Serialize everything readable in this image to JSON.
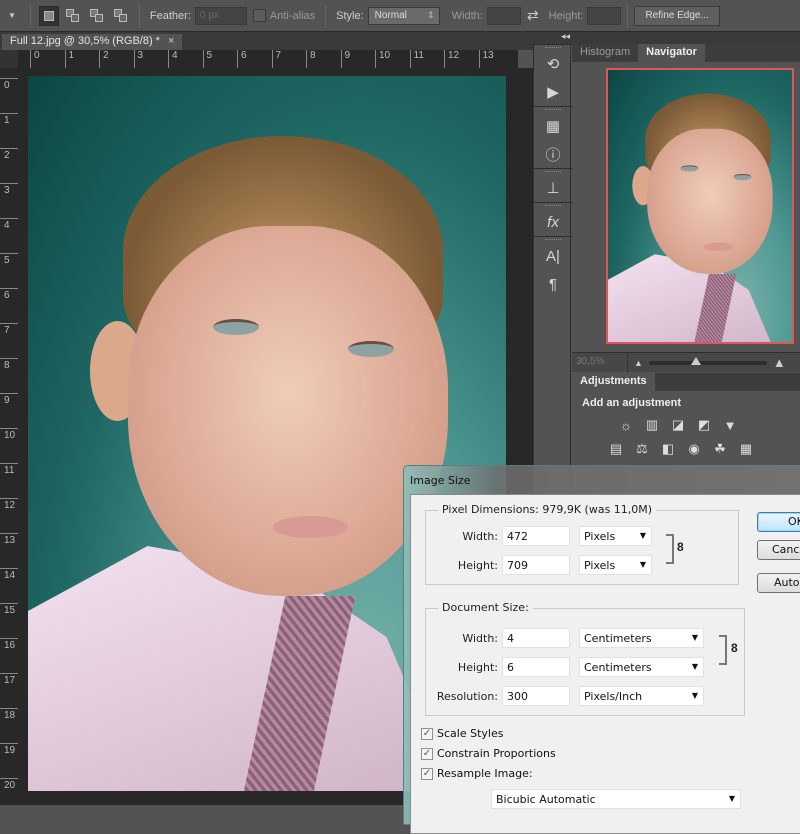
{
  "options_bar": {
    "feather_label": "Feather:",
    "feather_value": "0 px",
    "anti_alias_label": "Anti-alias",
    "style_label": "Style:",
    "style_value": "Normal",
    "width_label": "Width:",
    "height_label": "Height:",
    "refine_edge_label": "Refine Edge..."
  },
  "document": {
    "tab_title": "Full 12.jpg @ 30,5% (RGB/8) *",
    "close_glyph": "×",
    "ruler_h": [
      "0",
      "1",
      "2",
      "3",
      "4",
      "5",
      "6",
      "7",
      "8",
      "9",
      "10",
      "11",
      "12",
      "13"
    ],
    "ruler_v": [
      "0",
      "1",
      "2",
      "3",
      "4",
      "5",
      "6",
      "7",
      "8",
      "9",
      "10",
      "11",
      "12",
      "13",
      "14",
      "15",
      "16",
      "17",
      "18",
      "19",
      "20"
    ]
  },
  "panels": {
    "collapse_glyph": "◂◂",
    "tabs": [
      {
        "label": "Histogram",
        "active": false
      },
      {
        "label": "Navigator",
        "active": true
      }
    ],
    "navigator": {
      "zoom_value": "30,5%",
      "zoom_slider_fraction": 0.4
    },
    "adjustments": {
      "tab_label": "Adjustments",
      "title": "Add an adjustment",
      "row1_icons": [
        "brightness-contrast-icon",
        "levels-icon",
        "curves-icon",
        "exposure-icon",
        "vibrance-icon"
      ],
      "row2_icons": [
        "hue-saturation-icon",
        "color-balance-icon",
        "black-white-icon",
        "photo-filter-icon",
        "channel-mixer-icon",
        "color-lookup-icon"
      ]
    }
  },
  "dialog": {
    "title": "Image Size",
    "pixel_dimensions": {
      "legend": "Pixel Dimensions:  979,9K (was 11,0M)",
      "width_label": "Width:",
      "width_value": "472",
      "width_unit": "Pixels",
      "height_label": "Height:",
      "height_value": "709",
      "height_unit": "Pixels"
    },
    "document_size": {
      "legend": "Document Size:",
      "width_label": "Width:",
      "width_value": "4",
      "width_unit": "Centimeters",
      "height_label": "Height:",
      "height_value": "6",
      "height_unit": "Centimeters",
      "resolution_label": "Resolution:",
      "resolution_value": "300",
      "resolution_unit": "Pixels/Inch"
    },
    "checkboxes": [
      {
        "label": "Scale Styles",
        "checked": true
      },
      {
        "label": "Constrain Proportions",
        "checked": true
      },
      {
        "label": "Resample Image:",
        "checked": true
      }
    ],
    "resample_method": "Bicubic Automatic",
    "buttons": {
      "ok": "OK",
      "cancel": "Canc",
      "auto": "Auto"
    },
    "check_glyph": "✓",
    "dropdown_glyph": "▼",
    "link_glyph": "8"
  }
}
